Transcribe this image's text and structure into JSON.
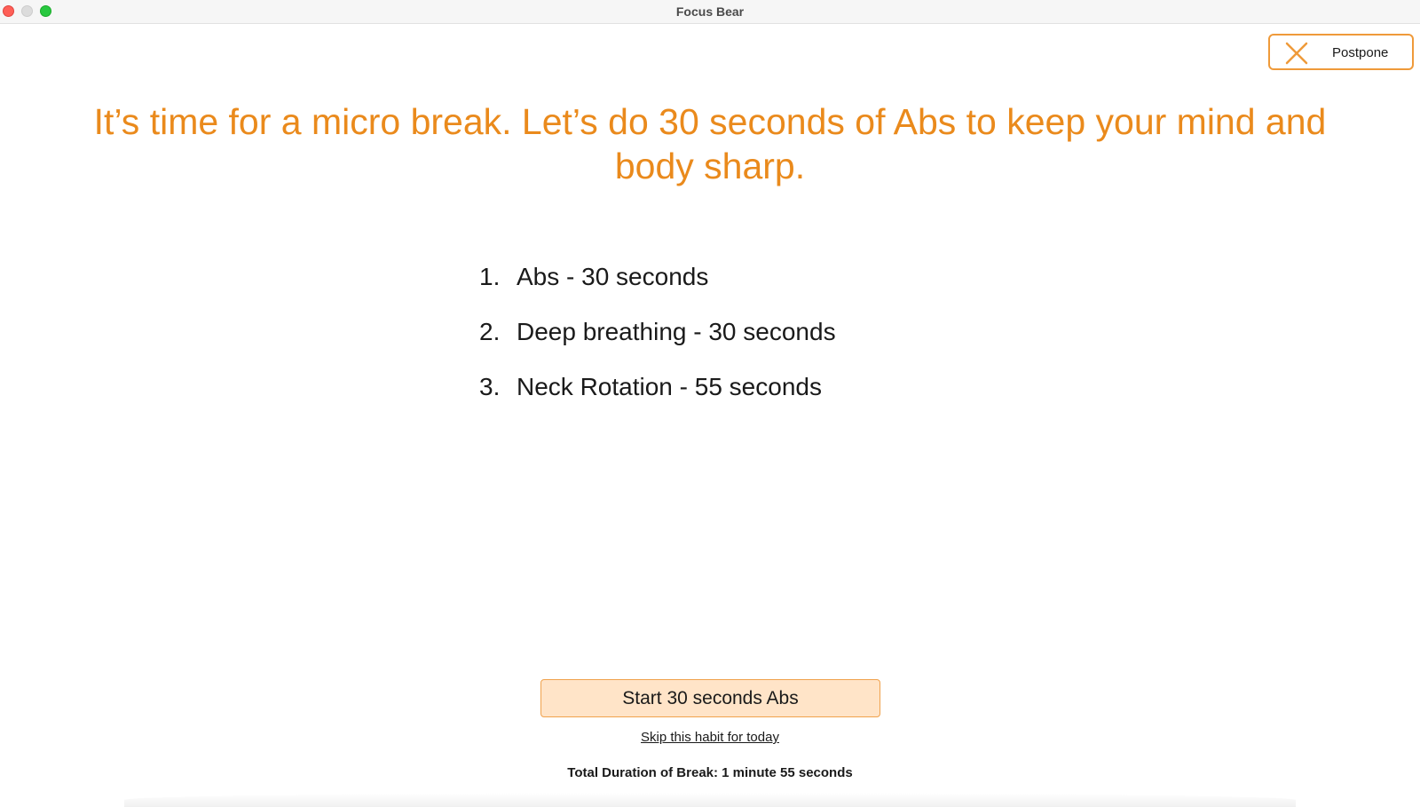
{
  "window": {
    "title": "Focus Bear"
  },
  "postpone": {
    "label": "Postpone",
    "icon": "close-icon"
  },
  "headline": "It’s time for a micro break. Let’s do 30 seconds of Abs to keep your mind and body sharp.",
  "habits": [
    {
      "number": "1.",
      "text": "Abs - 30 seconds"
    },
    {
      "number": "2.",
      "text": "Deep breathing - 30 seconds"
    },
    {
      "number": "3.",
      "text": "Neck Rotation - 55 seconds"
    }
  ],
  "start_button": {
    "label": "Start 30 seconds Abs"
  },
  "skip_link": {
    "label": "Skip this habit for today"
  },
  "total_duration": "Total Duration of Break: 1 minute 55 seconds",
  "colors": {
    "accent": "#ea8a1c",
    "button_fill": "#ffe4c8",
    "button_border": "#f0a24d"
  }
}
